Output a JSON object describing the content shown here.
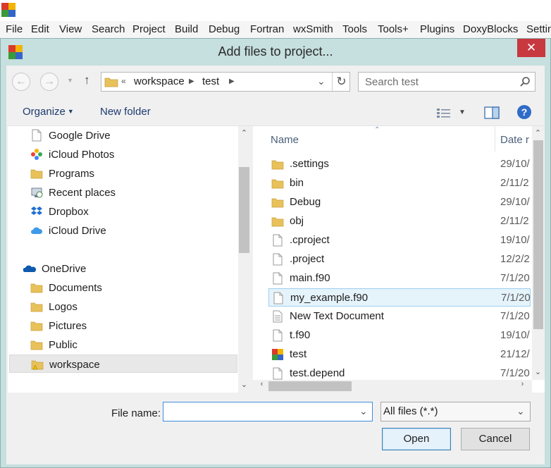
{
  "app": {
    "menu": [
      "File",
      "Edit",
      "View",
      "Search",
      "Project",
      "Build",
      "Debug",
      "Fortran",
      "wxSmith",
      "Tools",
      "Tools+",
      "Plugins",
      "DoxyBlocks",
      "Settin"
    ]
  },
  "dialog": {
    "title": "Add files to project...",
    "close_label": "✕"
  },
  "address": {
    "overflow": "«",
    "path": [
      "workspace",
      "test"
    ]
  },
  "search": {
    "placeholder": "Search test"
  },
  "toolbar": {
    "organize": "Organize",
    "new_folder": "New folder",
    "help": "?"
  },
  "nav": {
    "items": [
      {
        "label": "Google Drive",
        "icon": "file-icon"
      },
      {
        "label": "iCloud Photos",
        "icon": "icloud-photos-icon"
      },
      {
        "label": "Programs",
        "icon": "folder-icon"
      },
      {
        "label": "Recent places",
        "icon": "recent-places-icon"
      },
      {
        "label": "Dropbox",
        "icon": "dropbox-icon"
      },
      {
        "label": "iCloud Drive",
        "icon": "icloud-icon"
      },
      {
        "label": "OneDrive",
        "icon": "onedrive-icon"
      },
      {
        "label": "Documents",
        "icon": "folder-icon"
      },
      {
        "label": "Logos",
        "icon": "folder-icon"
      },
      {
        "label": "Pictures",
        "icon": "folder-icon"
      },
      {
        "label": "Public",
        "icon": "folder-icon"
      },
      {
        "label": "workspace",
        "icon": "folder-warning-icon"
      }
    ],
    "selected": "workspace"
  },
  "files": {
    "columns": {
      "name": "Name",
      "date": "Date r"
    },
    "rows": [
      {
        "name": ".settings",
        "date": "29/10/",
        "icon": "folder-icon"
      },
      {
        "name": "bin",
        "date": "2/11/2",
        "icon": "folder-icon"
      },
      {
        "name": "Debug",
        "date": "29/10/",
        "icon": "folder-icon"
      },
      {
        "name": "obj",
        "date": "2/11/2",
        "icon": "folder-icon"
      },
      {
        "name": ".cproject",
        "date": "19/10/",
        "icon": "file-icon"
      },
      {
        "name": ".project",
        "date": "12/2/2",
        "icon": "file-icon"
      },
      {
        "name": "main.f90",
        "date": "7/1/20",
        "icon": "file-icon"
      },
      {
        "name": "my_example.f90",
        "date": "7/1/20",
        "icon": "file-icon"
      },
      {
        "name": "New Text Document",
        "date": "7/1/20",
        "icon": "text-document-icon"
      },
      {
        "name": "t.f90",
        "date": "19/10/",
        "icon": "file-icon"
      },
      {
        "name": "test",
        "date": "21/12/",
        "icon": "codeblocks-project-icon"
      },
      {
        "name": "test.depend",
        "date": "7/1/20",
        "icon": "file-icon"
      }
    ],
    "selected": "my_example.f90"
  },
  "bottom": {
    "file_name_label": "File name:",
    "file_name_value": "",
    "filter": "All files (*.*)",
    "open": "Open",
    "cancel": "Cancel"
  },
  "colors": {
    "dialog_frame": "#c6dfdf",
    "close_button": "#c7383f",
    "selection": "#e5f3fb",
    "folder": "#e8c15a"
  }
}
